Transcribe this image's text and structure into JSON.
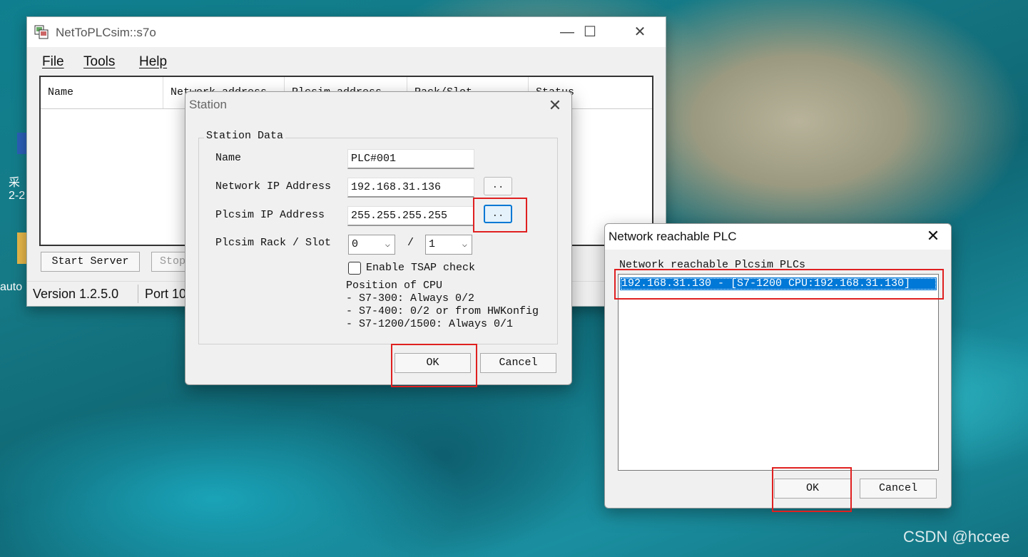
{
  "desktop": {
    "fragments": [
      "采",
      "2-2",
      "auto"
    ],
    "watermark": "CSDN @hccee"
  },
  "main_window": {
    "title": "NetToPLCsim::s7o",
    "controls": {
      "minimize": "—",
      "maximize": "☐",
      "close": "✕"
    },
    "menu": [
      "File",
      "Tools",
      "Help"
    ],
    "columns": [
      "Name",
      "Network address",
      "Plcsim address",
      "Rack/Slot",
      "Status"
    ],
    "buttons": {
      "start": "Start Server",
      "stop": "Stop"
    },
    "status": {
      "version": "Version 1.2.5.0",
      "port": "Port 10"
    }
  },
  "station_dialog": {
    "title": "Station",
    "group_title": "Station Data",
    "fields": {
      "name_label": "Name",
      "name_value": "PLC#001",
      "network_ip_label": "Network IP Address",
      "network_ip_value": "192.168.31.136",
      "plcsim_ip_label": "Plcsim IP Address",
      "plcsim_ip_value": "255.255.255.255",
      "rack_slot_label": "Plcsim Rack / Slot",
      "rack_value": "0",
      "slot_separator": "/",
      "slot_value": "1",
      "tsap_label": "Enable TSAP check",
      "tsap_checked": false
    },
    "browse_label": "..",
    "position_note": {
      "title": "Position of CPU",
      "lines": [
        "- S7-300: Always 0/2",
        "- S7-400: 0/2 or from HWKonfig",
        "- S7-1200/1500: Always 0/1"
      ]
    },
    "ok": "OK",
    "cancel": "Cancel"
  },
  "network_dialog": {
    "title": "Network reachable PLC",
    "list_label": "Network reachable Plcsim PLCs",
    "items": [
      "192.168.31.130 - [S7-1200 CPU:192.168.31.130]"
    ],
    "ok": "OK",
    "cancel": "Cancel"
  },
  "colors": {
    "highlight_box": "#e02020",
    "selection": "#0078d7",
    "focus": "#0078d4"
  }
}
